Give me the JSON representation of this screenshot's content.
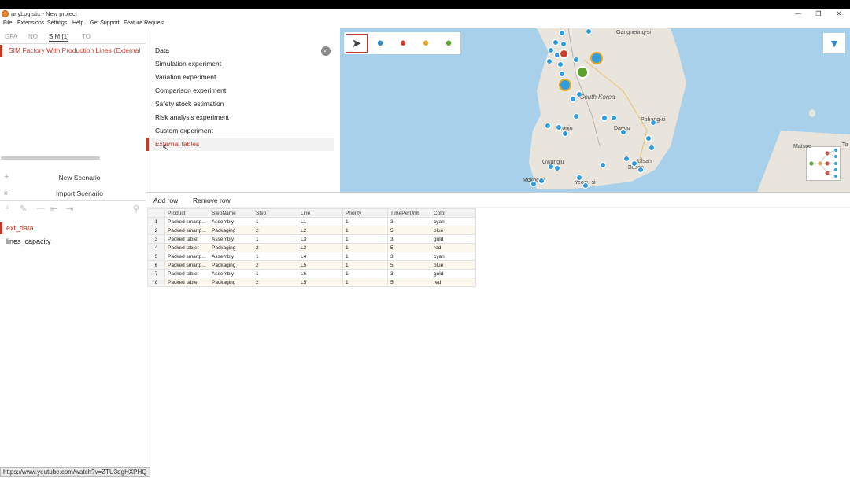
{
  "window": {
    "title": "anyLogistix - New project"
  },
  "menu": [
    "File",
    "Extensions",
    "Settings",
    "Help",
    "Get Support",
    "Feature Request"
  ],
  "left_tabs": [
    {
      "label": "GFA"
    },
    {
      "label": "NO"
    },
    {
      "label": "SIM [1]"
    },
    {
      "label": "TO"
    }
  ],
  "scenario": {
    "name": "SIM Factory With Production Lines (External Tables)"
  },
  "side_actions": {
    "new_scenario": "New Scenario",
    "import_scenario": "Import Scenario"
  },
  "tables": [
    "ext_data",
    "lines_capacity"
  ],
  "experiments": [
    "Data",
    "Simulation experiment",
    "Variation experiment",
    "Comparison experiment",
    "Safety stock estimation",
    "Risk analysis experiment",
    "Custom experiment",
    "External tables"
  ],
  "map": {
    "labels": [
      "Gangneung-si",
      "South Korea",
      "Daegu",
      "Pohang-si",
      "Gwangju",
      "Ulsan",
      "Busan",
      "Mokpo-si",
      "Yeosu-si",
      "Jeonju",
      "Matsue",
      "To"
    ]
  },
  "table_tools": {
    "add_row": "Add row",
    "remove_row": "Remove row"
  },
  "grid": {
    "columns": [
      "Product",
      "StepName",
      "Step",
      "Line",
      "Priority",
      "TimePerUnit",
      "Color"
    ],
    "rows": [
      [
        "1",
        "Packed smartp...",
        "Assembly",
        "1",
        "L1",
        "1",
        "3",
        "cyan"
      ],
      [
        "2",
        "Packed smartp...",
        "Packaging",
        "2",
        "L2",
        "1",
        "5",
        "blue"
      ],
      [
        "3",
        "Packed tablet",
        "Assembly",
        "1",
        "L3",
        "1",
        "3",
        "gold"
      ],
      [
        "4",
        "Packed tablet",
        "Packaging",
        "2",
        "L2",
        "1",
        "5",
        "red"
      ],
      [
        "5",
        "Packed smartp...",
        "Assembly",
        "1",
        "L4",
        "1",
        "3",
        "cyan"
      ],
      [
        "6",
        "Packed smartp...",
        "Packaging",
        "2",
        "L5",
        "1",
        "5",
        "blue"
      ],
      [
        "7",
        "Packed tablet",
        "Assembly",
        "1",
        "L6",
        "1",
        "3",
        "gold"
      ],
      [
        "8",
        "Packed tablet",
        "Packaging",
        "2",
        "L5",
        "1",
        "5",
        "red"
      ]
    ]
  },
  "status": {
    "url": "https://www.youtube.com/watch?v=ZTU3qgHXPHQ"
  },
  "colors": {
    "accent": "#c0392b",
    "pin": "#2e9ee0"
  }
}
